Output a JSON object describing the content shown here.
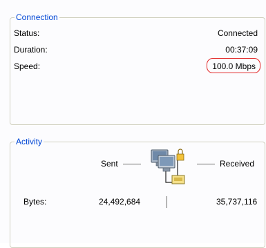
{
  "connection": {
    "title": "Connection",
    "status_label": "Status:",
    "status_value": "Connected",
    "duration_label": "Duration:",
    "duration_value": "00:37:09",
    "speed_label": "Speed:",
    "speed_value": "100.0 Mbps"
  },
  "activity": {
    "title": "Activity",
    "sent_label": "Sent",
    "received_label": "Received",
    "bytes_label": "Bytes:",
    "bytes_sent": "24,492,684",
    "bytes_received": "35,737,116"
  },
  "colors": {
    "legend_text": "#0046d5",
    "highlight_circle": "#e22626",
    "group_border": "#d0d0bf"
  },
  "icons": {
    "network": "network-activity-icon"
  }
}
